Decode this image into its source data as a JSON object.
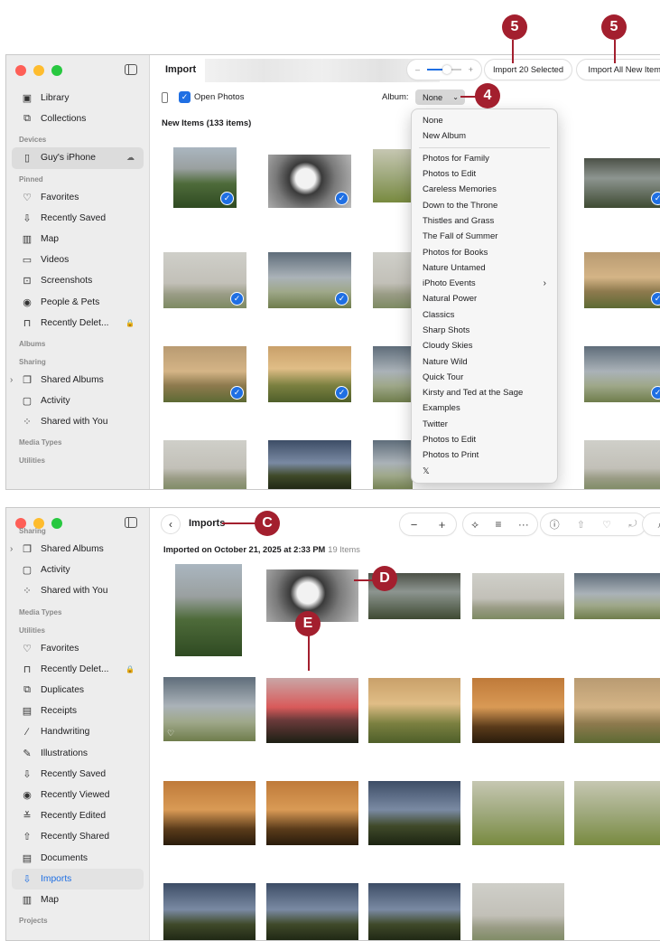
{
  "top_window": {
    "title": "Import",
    "sidebar": {
      "sections": [
        {
          "header": "",
          "items": [
            {
              "label": "Library",
              "icon": "library-icon"
            },
            {
              "label": "Collections",
              "icon": "collections-icon"
            }
          ]
        },
        {
          "header": "Devices",
          "items": [
            {
              "label": "Guy's iPhone",
              "icon": "iphone-icon",
              "selected": true,
              "trailing": "cloud-icon"
            }
          ]
        },
        {
          "header": "Pinned",
          "items": [
            {
              "label": "Favorites",
              "icon": "heart-icon"
            },
            {
              "label": "Recently Saved",
              "icon": "recently-saved-icon"
            },
            {
              "label": "Map",
              "icon": "map-icon"
            },
            {
              "label": "Videos",
              "icon": "video-icon"
            },
            {
              "label": "Screenshots",
              "icon": "screenshot-icon"
            },
            {
              "label": "People & Pets",
              "icon": "person-icon"
            },
            {
              "label": "Recently Delet...",
              "icon": "trash-icon",
              "locked": true
            }
          ]
        },
        {
          "header": "Albums",
          "items": []
        },
        {
          "header": "Sharing",
          "items": [
            {
              "label": "Shared Albums",
              "icon": "shared-albums-icon",
              "disclosure": true
            },
            {
              "label": "Activity",
              "icon": "activity-icon"
            },
            {
              "label": "Shared with You",
              "icon": "shared-with-you-icon"
            }
          ]
        },
        {
          "header": "Media Types",
          "items": []
        },
        {
          "header": "Utilities",
          "items": []
        }
      ]
    },
    "toolbar": {
      "import_selected": "Import 20 Selected",
      "import_all": "Import All New Items",
      "open_photos": "Open Photos",
      "album_label": "Album:",
      "album_value": "None"
    },
    "new_items_header": "New Items (133 items)",
    "album_menu": [
      "None",
      "New Album",
      "—",
      "Photos for Family",
      "Photos to Edit",
      "Careless Memories",
      "Down to the Throne",
      "Thistles and Grass",
      "The Fall of Summer",
      "Photos for Books",
      "Nature Untamed",
      "iPhoto Events",
      "Natural Power",
      "Classics",
      "Sharp Shots",
      "Cloudy Skies",
      "Nature Wild",
      "Quick Tour",
      "Kirsty and Ted at the Sage",
      "Examples",
      "Twitter",
      "Photos to Edit",
      "Photos to Print",
      "𝕏"
    ],
    "album_menu_submenu_item": "iPhoto Events"
  },
  "bottom_window": {
    "title": "Imports",
    "imported_on": "Imported on October 21, 2025 at 2:33 PM",
    "item_count": "19 Items",
    "sidebar": {
      "items": [
        {
          "type": "section",
          "label": "Sharing"
        },
        {
          "type": "item",
          "label": "Shared Albums",
          "icon": "shared-albums-icon",
          "disclosure": true
        },
        {
          "type": "item",
          "label": "Activity",
          "icon": "activity-icon"
        },
        {
          "type": "item",
          "label": "Shared with You",
          "icon": "shared-with-you-icon"
        },
        {
          "type": "section",
          "label": "Media Types"
        },
        {
          "type": "section",
          "label": "Utilities"
        },
        {
          "type": "item",
          "label": "Favorites",
          "icon": "heart-icon"
        },
        {
          "type": "item",
          "label": "Recently Delet...",
          "icon": "trash-icon",
          "locked": true
        },
        {
          "type": "item",
          "label": "Duplicates",
          "icon": "duplicates-icon"
        },
        {
          "type": "item",
          "label": "Receipts",
          "icon": "receipts-icon"
        },
        {
          "type": "item",
          "label": "Handwriting",
          "icon": "handwriting-icon"
        },
        {
          "type": "item",
          "label": "Illustrations",
          "icon": "illustrations-icon"
        },
        {
          "type": "item",
          "label": "Recently Saved",
          "icon": "recently-saved-icon"
        },
        {
          "type": "item",
          "label": "Recently Viewed",
          "icon": "eye-icon"
        },
        {
          "type": "item",
          "label": "Recently Edited",
          "icon": "sliders-icon"
        },
        {
          "type": "item",
          "label": "Recently Shared",
          "icon": "recently-shared-icon"
        },
        {
          "type": "item",
          "label": "Documents",
          "icon": "document-icon"
        },
        {
          "type": "item",
          "label": "Imports",
          "icon": "imports-icon",
          "active": true
        },
        {
          "type": "item",
          "label": "Map",
          "icon": "map-icon"
        },
        {
          "type": "section",
          "label": "Projects"
        }
      ]
    }
  },
  "callouts": {
    "c5a": "5",
    "c5b": "5",
    "c4": "4",
    "cC": "C",
    "cD": "D",
    "cE": "E"
  },
  "colors": {
    "accent": "#1f6fe3",
    "callout": "#a31f2e"
  }
}
